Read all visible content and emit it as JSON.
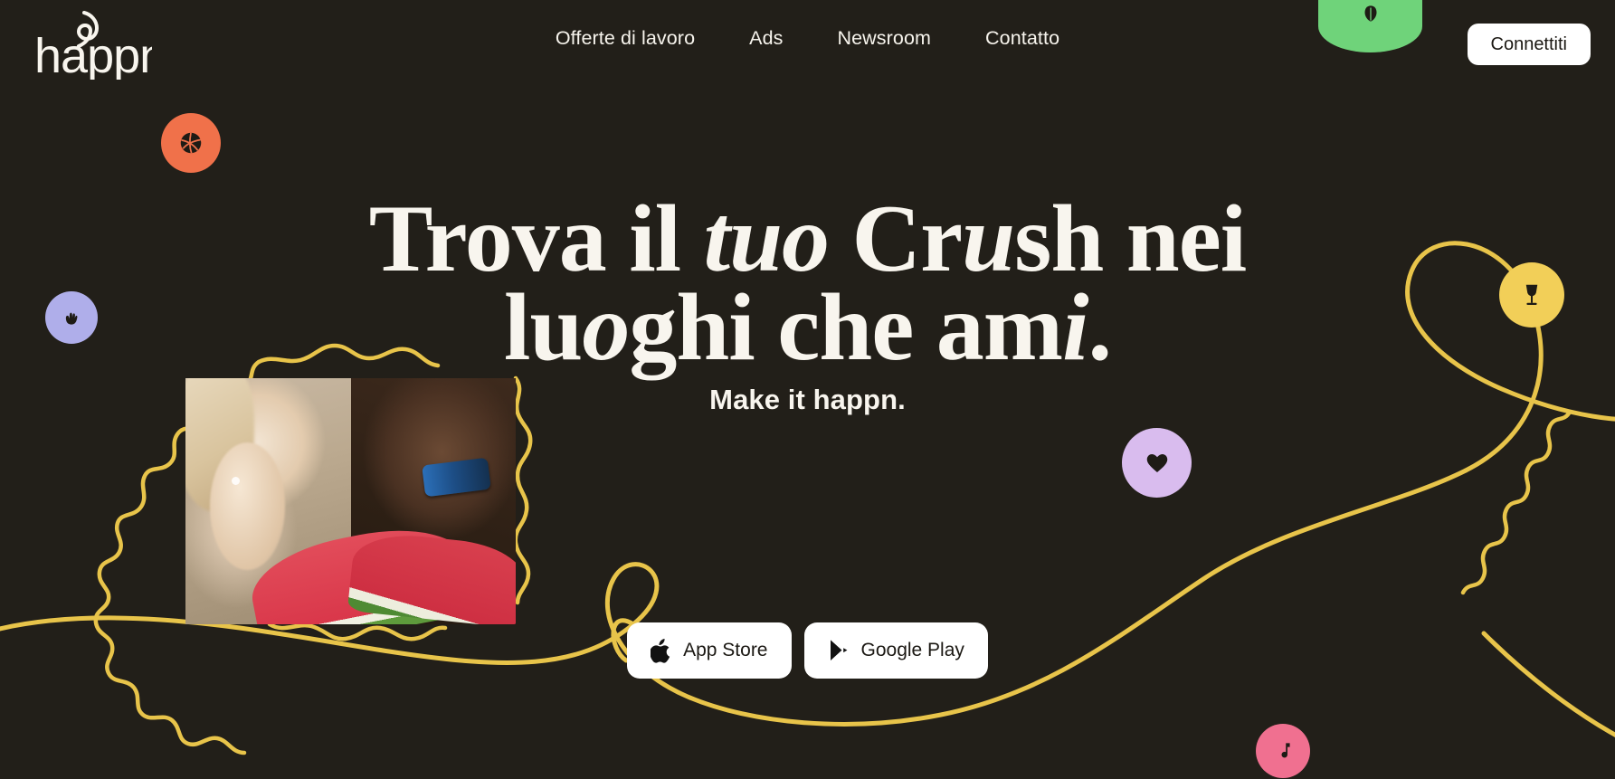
{
  "brand": {
    "name": "happn",
    "logo_icon": "happn-swirl-icon"
  },
  "colors": {
    "background": "#221F19",
    "text_cream": "#F8F5EE",
    "button_white": "#FFFFFF",
    "button_text": "#1B1813",
    "squiggle_yellow": "#E8C44A",
    "accent_orange": "#F0714A",
    "accent_periwinkle": "#AFAEEA",
    "accent_green": "#6FD37A",
    "accent_yellow": "#F2CF58",
    "accent_lavender": "#D9BCEE",
    "accent_pink": "#F07090"
  },
  "header": {
    "nav_items": [
      {
        "label": "Offerte di lavoro",
        "name": "nav-item-jobs"
      },
      {
        "label": "Ads",
        "name": "nav-item-ads"
      },
      {
        "label": "Newsroom",
        "name": "nav-item-newsroom"
      },
      {
        "label": "Contatto",
        "name": "nav-item-contact"
      }
    ],
    "connect_label": "Connettiti"
  },
  "hero": {
    "headline_line1_a": "Trova il ",
    "headline_line1_b": "tu",
    "headline_line1_c": "o",
    "headline_line1_d": " Cr",
    "headline_line1_e": "u",
    "headline_line1_f": "sh nei",
    "headline_line2_a": "lu",
    "headline_line2_b": "o",
    "headline_line2_c": "ghi che am",
    "headline_line2_d": "i",
    "headline_line2_e": ".",
    "subtitle": "Make it happn.",
    "app_store_label": "App Store",
    "google_play_label": "Google Play",
    "app_store_icon": "apple-logo-icon",
    "google_play_icon": "google-play-icon"
  },
  "decorations": [
    {
      "name": "blob-basketball",
      "icon": "basketball-icon",
      "color": "#F0714A"
    },
    {
      "name": "blob-hand-wave",
      "icon": "hand-icon",
      "color": "#AFAEEA"
    },
    {
      "name": "half-disc-green",
      "icon": "leaf-icon",
      "color": "#6FD37A"
    },
    {
      "name": "blob-wine-glass",
      "icon": "wine-glass-icon",
      "color": "#F2CF58"
    },
    {
      "name": "blob-heart-lavender",
      "icon": "heart-icon",
      "color": "#D9BCEE"
    },
    {
      "name": "blob-music-note",
      "icon": "music-note-icon",
      "color": "#F07090"
    },
    {
      "name": "squiggle-path",
      "icon": "squiggle-line-icon",
      "color": "#E8C44A"
    },
    {
      "name": "hero-photo",
      "icon": "couple-watermelon-photo"
    }
  ]
}
